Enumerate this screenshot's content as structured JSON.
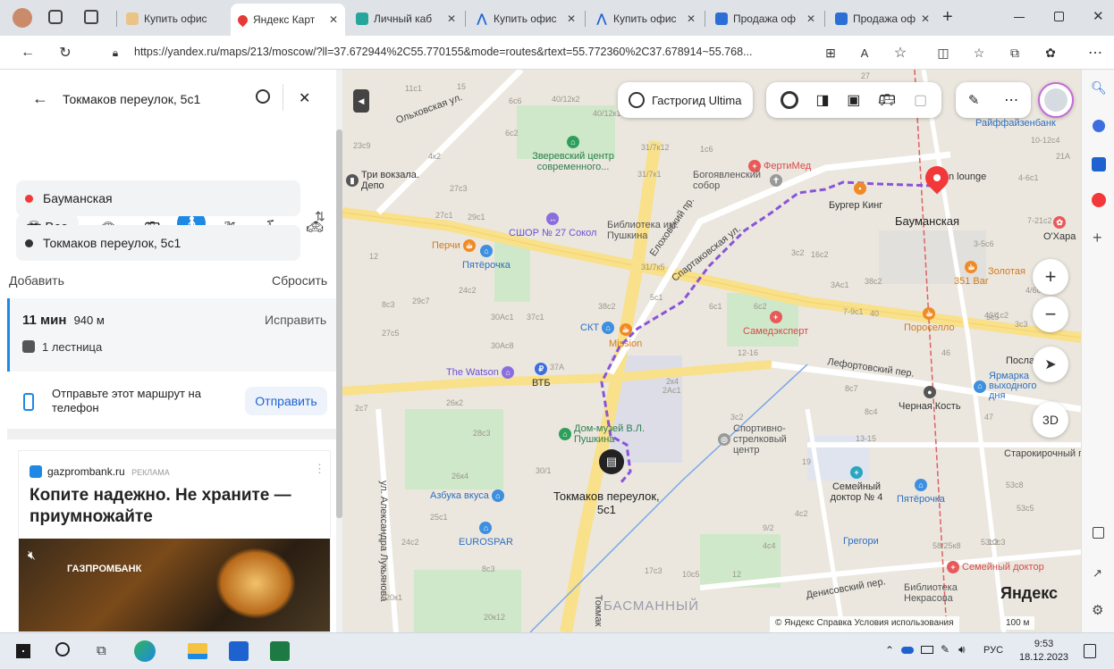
{
  "browser": {
    "tabs": [
      {
        "label": "Купить офис",
        "color": "#f5a623"
      },
      {
        "label": "Яндекс Карт",
        "color": "#e53935"
      },
      {
        "label": "Личный каб",
        "color": "#26a69a"
      },
      {
        "label": "Купить офис",
        "color": "#1e62d0"
      },
      {
        "label": "Купить офис",
        "color": "#1e62d0"
      },
      {
        "label": "Продажа оф",
        "color": "#2b6fd6"
      },
      {
        "label": "Продажа оф",
        "color": "#2b6fd6"
      }
    ],
    "new_tab": "+",
    "url": "https://yandex.ru/maps/213/moscow/?ll=37.672944%2C55.770155&mode=routes&rtext=55.772360%2C37.678914~55.768..."
  },
  "sidebar": {
    "search_value": "Токмаков переулок, 5с1",
    "modes": {
      "all_label": "Все"
    },
    "route_from": "Бауманская",
    "route_to": "Токмаков переулок, 5с1",
    "add_label": "Добавить",
    "reset_label": "Сбросить",
    "route_time": "11 мин",
    "route_distance": "940 м",
    "edit_label": "Исправить",
    "route_note": "1 лестница",
    "send_text": "Отправьте этот маршрут на телефон",
    "send_button": "Отправить",
    "ad": {
      "source": "gazprombank.ru",
      "tag": "РЕКЛАМА",
      "headline": "Копите надежно. Не храните — приумножайте",
      "brand": "ГАЗПРОМБАНК"
    }
  },
  "map": {
    "gastroguide": "Гастрогид Ultima",
    "zoom_in": "+",
    "zoom_out": "−",
    "btn_3d": "3D",
    "destination_label_1": "Токмаков переулок,",
    "destination_label_2": "5с1",
    "origin_label": "Бауманская",
    "yandex_logo": "Яндекс",
    "copyright": "© Яндекс  Справка  Условия использования",
    "scale": "100 м",
    "streets": [
      "Ольховская ул.",
      "Спартаковская ул.",
      "Елоховский пр.",
      "Лефортовский пер.",
      "Старокирочный п",
      "ул. Александра Лукьянова",
      "Денисовский пер.",
      "Токмак",
      "БАСМАННЫЙ"
    ],
    "pois": [
      {
        "name": "Зверевский центр современного...",
        "color": "#2e9e5b"
      },
      {
        "name": "ФертиМед",
        "color": "#e85a5a"
      },
      {
        "name": "Богоявленский собор",
        "color": "#888"
      },
      {
        "name": "Бургер Кинг",
        "color": "#f08a24"
      },
      {
        "name": "Библиотека им. Пушкина",
        "color": "#888"
      },
      {
        "name": "СШОР № 27 Сокол",
        "color": "#8a6ee0"
      },
      {
        "name": "Перчи",
        "color": "#f08a24"
      },
      {
        "name": "Пятёрочка",
        "color": "#3d8fe0"
      },
      {
        "name": "СКТ",
        "color": "#3d8fe0"
      },
      {
        "name": "Mission",
        "color": "#f08a24"
      },
      {
        "name": "Самедэксперт",
        "color": "#e85a5a"
      },
      {
        "name": "The Watson",
        "color": "#8a6ee0"
      },
      {
        "name": "ВТБ",
        "color": "#3d6ee0"
      },
      {
        "name": "Дом-музей В.Л. Пушкина",
        "color": "#2e9e5b"
      },
      {
        "name": "Спортивно-стрелковый центр",
        "color": "#888"
      },
      {
        "name": "Черная Кость",
        "color": "#555"
      },
      {
        "name": "Азбука вкуса",
        "color": "#3d8fe0"
      },
      {
        "name": "EUROSPAR",
        "color": "#3d8fe0"
      },
      {
        "name": "Семейный доктор № 4",
        "color": "#2aa6c0"
      },
      {
        "name": "Пятёрочка",
        "color": "#3d8fe0"
      },
      {
        "name": "Грегори",
        "color": "#3d8fe0"
      },
      {
        "name": "Семейный доктор",
        "color": "#e85a5a"
      },
      {
        "name": "Библиотека Некрасова",
        "color": "#888"
      },
      {
        "name": "Райффайзенбанк",
        "color": "#3d8fe0"
      },
      {
        "name": "O'Хара",
        "color": "#e85a5a"
      },
      {
        "name": "Золотая",
        "color": "#f08a24"
      },
      {
        "name": "351 Bar",
        "color": "#f08a24"
      },
      {
        "name": "Пороселло",
        "color": "#f08a24"
      },
      {
        "name": "Ярмарка выходного дня",
        "color": "#3d8fe0"
      },
      {
        "name": "Три вокзала. Депо",
        "color": "#555"
      },
      {
        "name": "Посла",
        "color": "#555"
      },
      {
        "name": "n lounge",
        "color": "#f08a24"
      }
    ],
    "house_numbers": [
      "11с1",
      "15",
      "6с6",
      "40/12к2",
      "40/12к1",
      "6с2",
      "23с9",
      "4к2",
      "27с3",
      "29с1",
      "27с1",
      "12",
      "24с2",
      "29с7",
      "8с3",
      "30Ас1",
      "37с1",
      "38с2",
      "30Ас8",
      "27с5",
      "37А",
      "26к2",
      "2к4",
      "2Ас1",
      "28с3",
      "30/1",
      "26к4",
      "25с1",
      "24с2",
      "8с3",
      "17с3",
      "10с5",
      "20к1",
      "20к12",
      "31/7к12",
      "1с6",
      "31/7к1",
      "31/7к5",
      "5с1",
      "3с2",
      "16с2",
      "3Ас1",
      "38с2",
      "6с2",
      "6с1",
      "7-9с1",
      "40",
      "8с7",
      "8с4",
      "13-15",
      "47",
      "53с8",
      "53с5",
      "53с2",
      "10-12с4",
      "4-6с1",
      "7-21с2",
      "3-5с6",
      "43/1с2",
      "3с5",
      "58/25к8",
      "12-16",
      "2с7",
      "3с2",
      "4с2",
      "9/2",
      "10с3",
      "12",
      "4с4",
      "46",
      "19",
      "21А",
      "4/6с",
      "3с3",
      "27"
    ]
  },
  "edge_icons": [
    "search-icon",
    "copilot-icon",
    "outlook-icon",
    "yandex-icon",
    "add-icon",
    "sidebar-icon",
    "open-external-icon",
    "settings-icon"
  ],
  "taskbar": {
    "lang": "РУС",
    "time": "9:53",
    "date": "18.12.2023"
  }
}
